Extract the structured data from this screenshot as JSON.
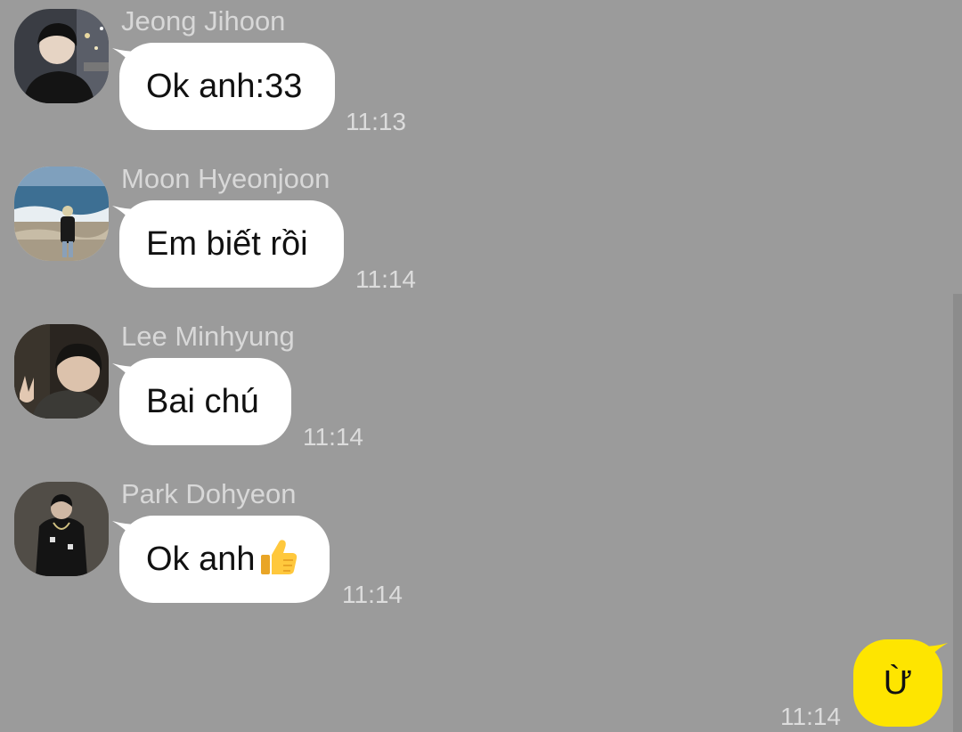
{
  "chat": {
    "messages": [
      {
        "sender": "Jeong Jihoon",
        "text": "Ok anh:33",
        "time": "11:13",
        "avatar": "person-dark-jacket-city-night-avatar"
      },
      {
        "sender": "Moon Hyeonjoon",
        "text": "Em biết rồi",
        "time": "11:14",
        "avatar": "person-on-beach-avatar"
      },
      {
        "sender": "Lee Minhyung",
        "text": "Bai chú",
        "time": "11:14",
        "avatar": "selfie-peace-sign-avatar"
      },
      {
        "sender": "Park Dohyeon",
        "text": "Ok anh",
        "emoji": "thumbs-up",
        "time": "11:14",
        "avatar": "person-black-outfit-avatar"
      }
    ],
    "my_message": {
      "text": "Ừ",
      "time": "11:14"
    }
  },
  "colors": {
    "background": "#9b9b9b",
    "incoming_bubble": "#ffffff",
    "outgoing_bubble": "#fee500",
    "meta_text": "#d8d8d8"
  }
}
